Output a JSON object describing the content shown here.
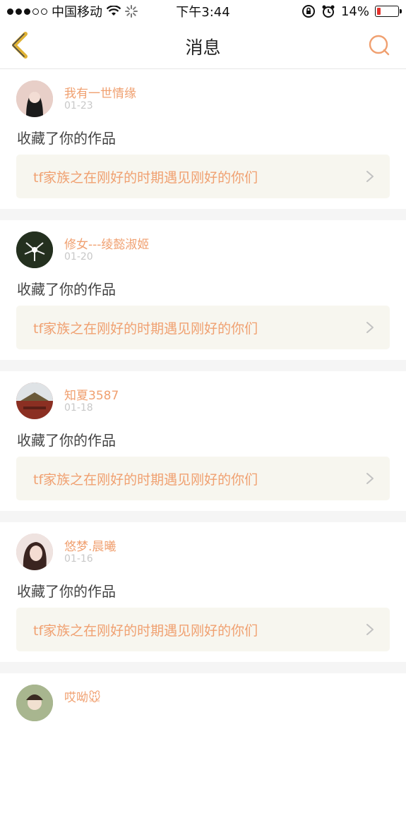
{
  "status_bar": {
    "carrier": "中国移动",
    "time": "下午3:44",
    "battery": "14%"
  },
  "nav": {
    "title": "消息",
    "icons": [
      "back-chevron-icon",
      "search-icon"
    ]
  },
  "messages": [
    {
      "user": "我有一世情缘",
      "date": "01-23",
      "action": "收藏了你的作品",
      "work": "tf家族之在刚好的时期遇见刚好的你们",
      "avatar_color": "#d8b7b0"
    },
    {
      "user": "修女---绫懿淑姬",
      "date": "01-20",
      "action": "收藏了你的作品",
      "work": "tf家族之在刚好的时期遇见刚好的你们",
      "avatar_color": "#2f3b2a"
    },
    {
      "user": "知夏3587",
      "date": "01-18",
      "action": "收藏了你的作品",
      "work": "tf家族之在刚好的时期遇见刚好的你们",
      "avatar_color": "#9a4a3a"
    },
    {
      "user": "悠梦.晨曦",
      "date": "01-16",
      "action": "收藏了你的作品",
      "work": "tf家族之在刚好的时期遇见刚好的你们",
      "avatar_color": "#d9b8b2"
    },
    {
      "user": "哎呦🐭",
      "date": "",
      "action": "",
      "work": "",
      "avatar_color": "#8fa07a"
    }
  ]
}
